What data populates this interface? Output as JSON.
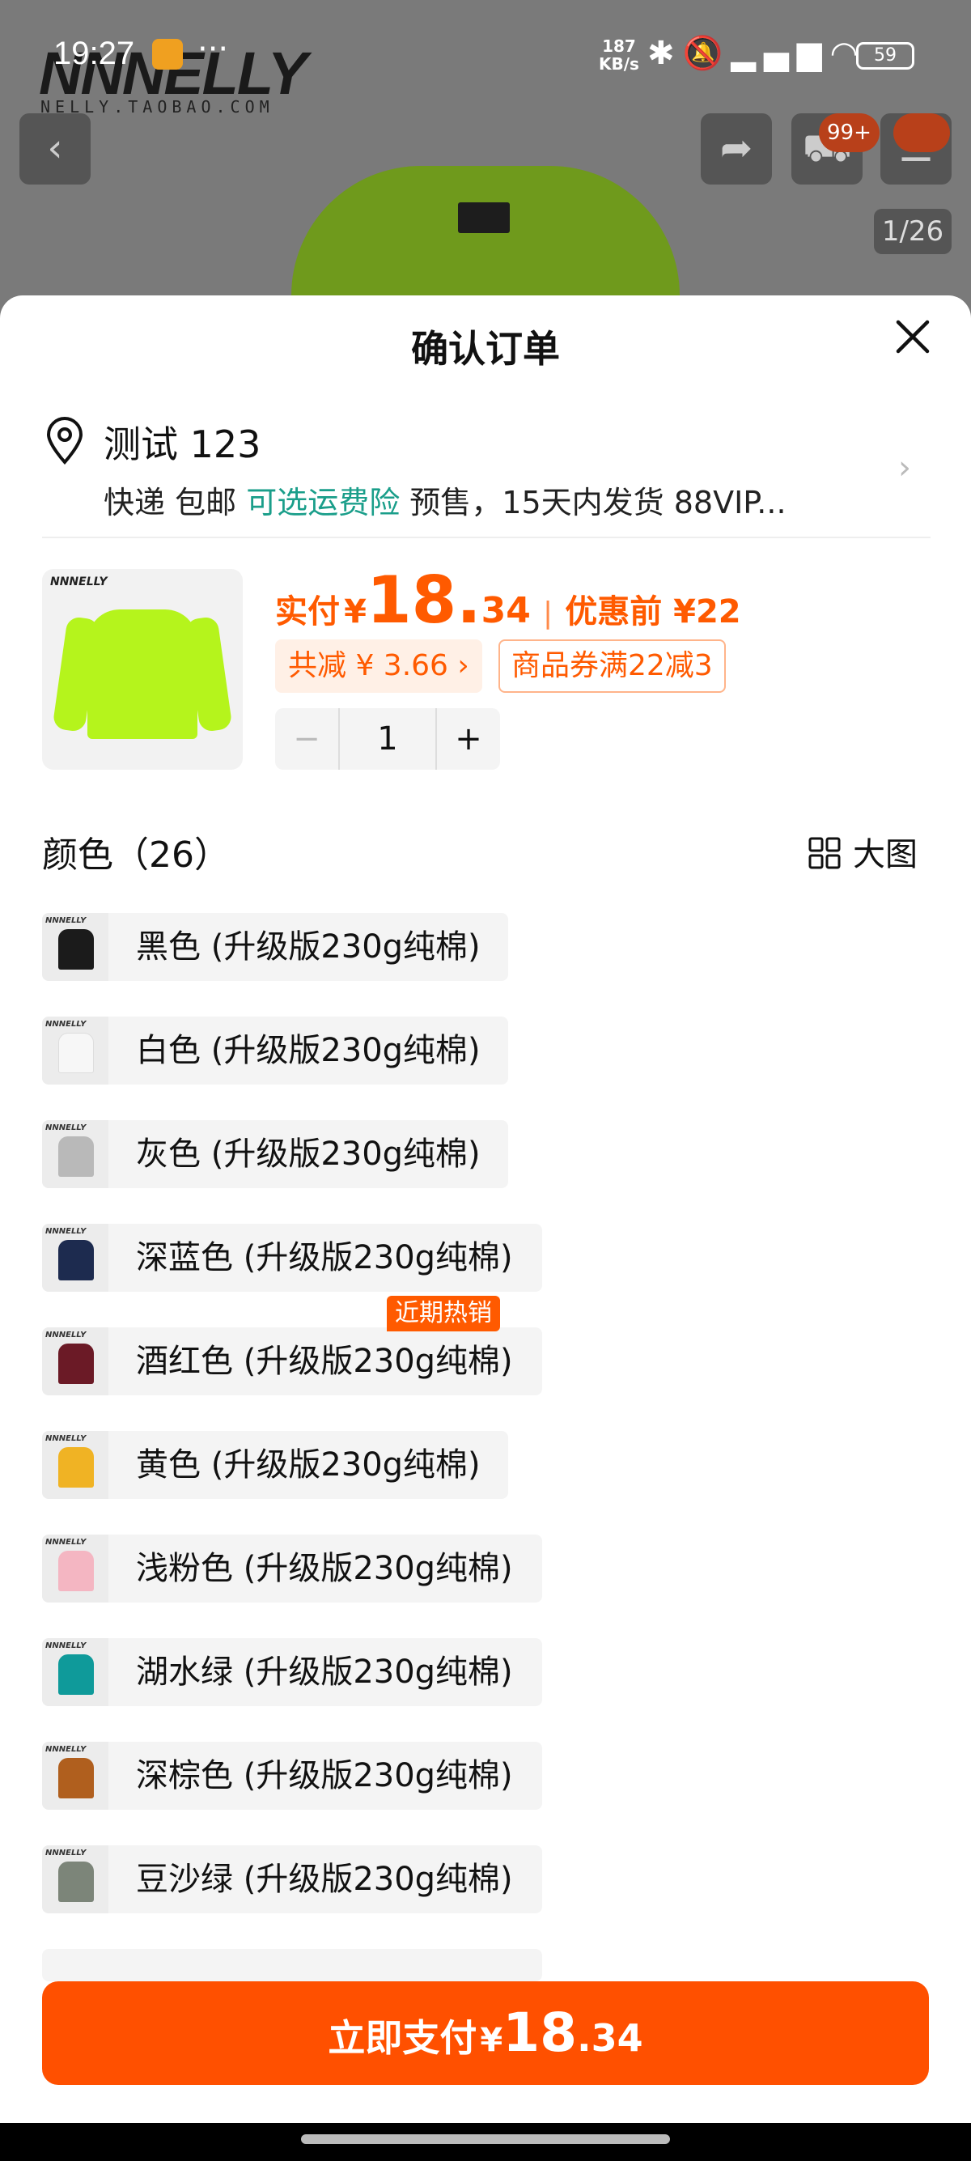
{
  "status_bar": {
    "time": "19:27",
    "dots": "···",
    "speed_value": "187",
    "speed_unit": "KB/s",
    "battery": "59",
    "icons": [
      "bluetooth-icon",
      "mute-icon",
      "hd-signal-icon",
      "wifi-icon"
    ]
  },
  "background_page": {
    "brand_logo": "NNNELLY",
    "brand_site": "NELLY.TAOBAO.COM",
    "cart_badge": "99+",
    "image_counter": "1/26"
  },
  "sheet": {
    "title": "确认订单",
    "address": {
      "name": "测试 123",
      "shipping_prefix": "快递 包邮",
      "shipping_insurance": "可选运费险",
      "shipping_suffix": "预售，15天内发货 88VIP..."
    },
    "product": {
      "pay_label": "实付",
      "currency": "¥",
      "price_int": "18.",
      "price_dec": "34",
      "orig_label": "优惠前 ¥22",
      "save_chip": "共减 ¥ 3.66 ›",
      "coupon_chip": "商品券满22减3",
      "quantity": "1",
      "minus": "−",
      "plus": "+"
    },
    "color_header": "颜色（26）",
    "big_view_label": "大图",
    "hot_tag": "近期热销",
    "variants": [
      {
        "label": "黑色 (升级版230g纯棉)",
        "color": "#1b1b1b"
      },
      {
        "label": "白色 (升级版230g纯棉)",
        "color": "#f7f7f7"
      },
      {
        "label": "灰色 (升级版230g纯棉)",
        "color": "#b9b9b9"
      },
      {
        "label": "深蓝色 (升级版230g纯棉)",
        "color": "#1d2b4f"
      },
      {
        "label": "酒红色 (升级版230g纯棉)",
        "color": "#6b1a26"
      },
      {
        "label": "黄色 (升级版230g纯棉)",
        "color": "#f0b324"
      },
      {
        "label": "浅粉色 (升级版230g纯棉)",
        "color": "#f4b6c2"
      },
      {
        "label": "湖水绿 (升级版230g纯棉)",
        "color": "#0f9a9a"
      },
      {
        "label": "深棕色 (升级版230g纯棉)",
        "color": "#b05f1e"
      },
      {
        "label": "豆沙绿 (升级版230g纯棉)",
        "color": "#7c8579"
      }
    ],
    "pay_button": {
      "text": "立即支付",
      "currency": "¥",
      "int": "18",
      "dec": ".34"
    }
  },
  "colors": {
    "accent": "#ff5000",
    "teal": "#1a9e8a",
    "product_color": "#b5f41c"
  }
}
